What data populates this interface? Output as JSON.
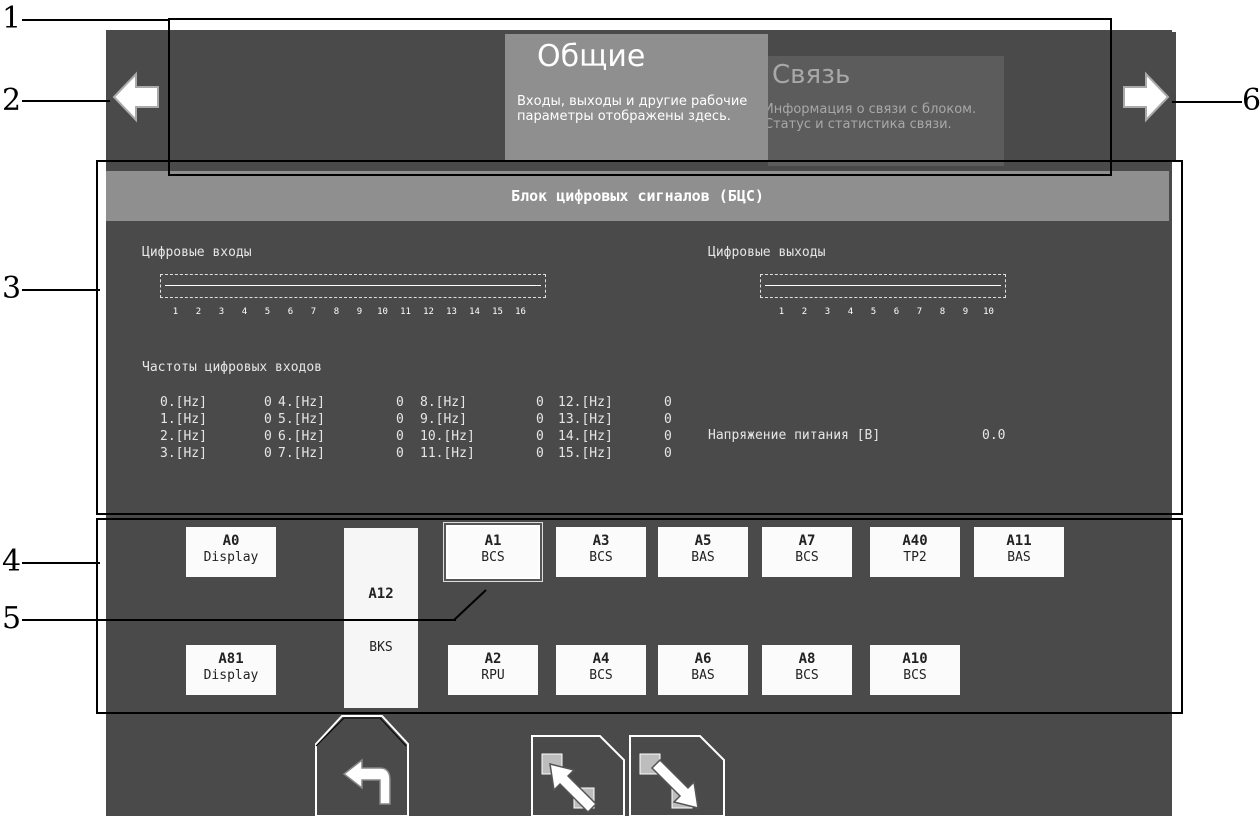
{
  "callouts": [
    "1",
    "2",
    "3",
    "4",
    "5",
    "6"
  ],
  "tabs": [
    {
      "title": "Общие",
      "description": "Входы, выходы и другие рабочие параметры отображены здесь."
    },
    {
      "title": "Связь",
      "description": "Информация о связи с блоком. Статус и статистика связи."
    }
  ],
  "nav": {
    "prev_icon": "arrow-left-icon",
    "next_icon": "arrow-right-icon"
  },
  "panel": {
    "title": "Блок цифровых сигналов (БЦС)",
    "inputs_label": "Цифровые входы",
    "outputs_label": "Цифровые выходы",
    "input_ticks": [
      "1",
      "2",
      "3",
      "4",
      "5",
      "6",
      "7",
      "8",
      "9",
      "10",
      "11",
      "12",
      "13",
      "14",
      "15",
      "16"
    ],
    "output_ticks": [
      "1",
      "2",
      "3",
      "4",
      "5",
      "6",
      "7",
      "8",
      "9",
      "10"
    ],
    "freq_label": "Частоты цифровых входов",
    "freq_columns": [
      [
        {
          "name": "0.[Hz]",
          "value": "0"
        },
        {
          "name": "1.[Hz]",
          "value": "0"
        },
        {
          "name": "2.[Hz]",
          "value": "0"
        },
        {
          "name": "3.[Hz]",
          "value": "0"
        }
      ],
      [
        {
          "name": "4.[Hz]",
          "value": "0"
        },
        {
          "name": "5.[Hz]",
          "value": "0"
        },
        {
          "name": "6.[Hz]",
          "value": "0"
        },
        {
          "name": "7.[Hz]",
          "value": "0"
        }
      ],
      [
        {
          "name": "8.[Hz]",
          "value": "0"
        },
        {
          "name": "9.[Hz]",
          "value": "0"
        },
        {
          "name": "10.[Hz]",
          "value": "0"
        },
        {
          "name": "11.[Hz]",
          "value": "0"
        }
      ],
      [
        {
          "name": "12.[Hz]",
          "value": "0"
        },
        {
          "name": "13.[Hz]",
          "value": "0"
        },
        {
          "name": "14.[Hz]",
          "value": "0"
        },
        {
          "name": "15.[Hz]",
          "value": "0"
        }
      ]
    ],
    "voltage_label": "Напряжение питания [В]",
    "voltage_value": "0.0"
  },
  "modules_top": [
    {
      "id": "A0",
      "type": "Display"
    },
    {
      "id": "A1",
      "type": "BCS",
      "selected": true
    },
    {
      "id": "A3",
      "type": "BCS"
    },
    {
      "id": "A5",
      "type": "BAS"
    },
    {
      "id": "A7",
      "type": "BCS"
    },
    {
      "id": "A40",
      "type": "TP2"
    },
    {
      "id": "A11",
      "type": "BAS"
    }
  ],
  "modules_bottom": [
    {
      "id": "A81",
      "type": "Display"
    },
    {
      "id": "A2",
      "type": "RPU"
    },
    {
      "id": "A4",
      "type": "BCS"
    },
    {
      "id": "A6",
      "type": "BAS"
    },
    {
      "id": "A8",
      "type": "BCS"
    },
    {
      "id": "A10",
      "type": "BCS"
    }
  ],
  "module_tall": {
    "id": "A12",
    "type": "BKS"
  },
  "toolbar": {
    "back_icon": "back-arrow-icon",
    "up_icon": "move-up-icon",
    "down_icon": "move-down-icon"
  }
}
